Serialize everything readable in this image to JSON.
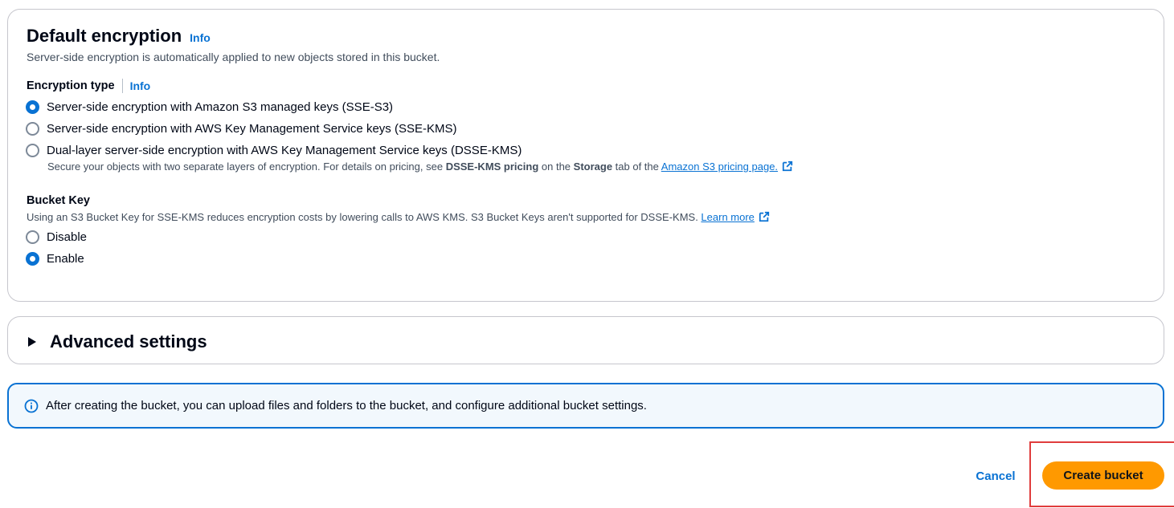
{
  "encryption": {
    "title": "Default encryption",
    "info": "Info",
    "description": "Server-side encryption is automatically applied to new objects stored in this bucket.",
    "type_label": "Encryption type",
    "type_info": "Info",
    "options": [
      {
        "label": "Server-side encryption with Amazon S3 managed keys (SSE-S3)",
        "checked": true
      },
      {
        "label": "Server-side encryption with AWS Key Management Service keys (SSE-KMS)",
        "checked": false
      },
      {
        "label": "Dual-layer server-side encryption with AWS Key Management Service keys (DSSE-KMS)",
        "checked": false
      }
    ],
    "dsse_note": {
      "prefix": "Secure your objects with two separate layers of encryption. For details on pricing, see ",
      "bold1": "DSSE-KMS pricing",
      "middle": " on the ",
      "bold2": "Storage",
      "suffix": " tab of the ",
      "link": "Amazon S3 pricing page."
    },
    "bucket_key": {
      "label": "Bucket Key",
      "description": "Using an S3 Bucket Key for SSE-KMS reduces encryption costs by lowering calls to AWS KMS. S3 Bucket Keys aren't supported for DSSE-KMS. ",
      "link": "Learn more",
      "options": [
        {
          "label": "Disable",
          "checked": false
        },
        {
          "label": "Enable",
          "checked": true
        }
      ]
    }
  },
  "advanced": {
    "title": "Advanced settings"
  },
  "alert": {
    "text": "After creating the bucket, you can upload files and folders to the bucket, and configure additional bucket settings."
  },
  "actions": {
    "cancel": "Cancel",
    "create": "Create bucket"
  },
  "colors": {
    "accent": "#0972d3",
    "primary_button": "#ff9900",
    "highlight": "#e03c3c"
  }
}
